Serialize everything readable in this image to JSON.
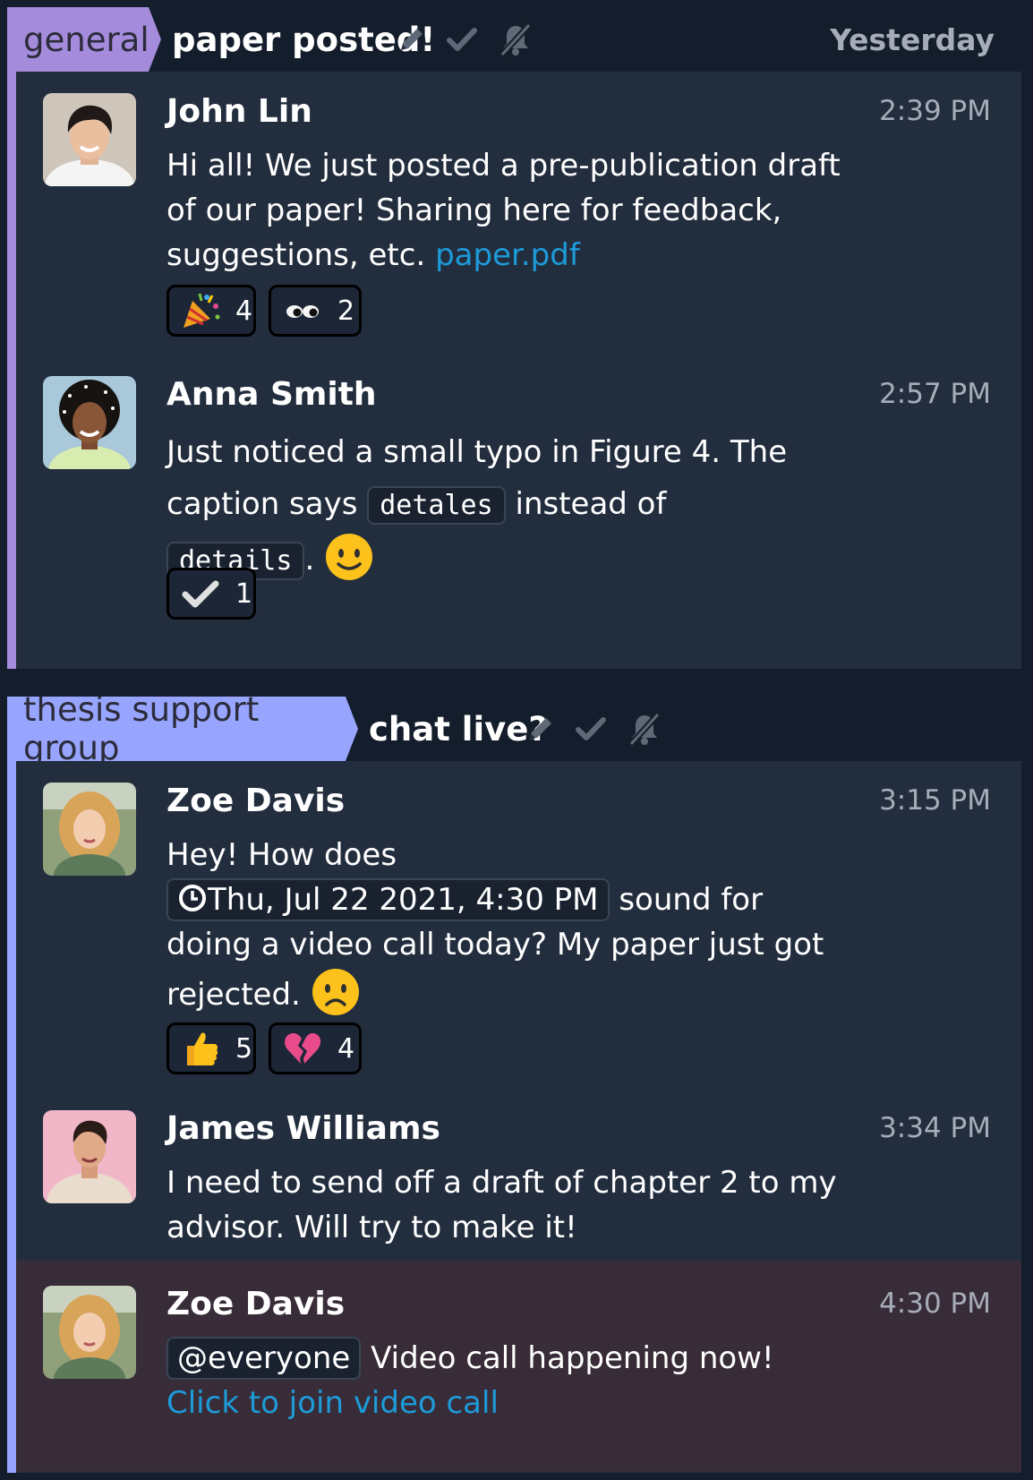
{
  "groups": [
    {
      "stream": "general",
      "stream_color": "#a48bdb",
      "topic": "paper posted!",
      "date": "Yesterday",
      "messages": [
        {
          "sender": "John Lin",
          "time": "2:39 PM",
          "text": "Hi all! We just posted a pre-publication draft of our paper! Sharing here for feedback, suggestions, etc. ",
          "link": "paper.pdf",
          "reactions": [
            {
              "emoji": "party-popper-icon",
              "count": "4"
            },
            {
              "emoji": "eyes-icon",
              "count": "2"
            }
          ]
        },
        {
          "sender": "Anna Smith",
          "time": "2:57 PM",
          "text_1": "Just noticed a small typo in Figure 4. The caption says ",
          "code_1": "detales",
          "text_2": " instead of",
          "code_2": "details",
          "text_3": ".",
          "reactions": [
            {
              "emoji": "check-icon",
              "count": "1"
            }
          ]
        }
      ]
    },
    {
      "stream": "thesis support group",
      "stream_color": "#97a5ff",
      "topic": "chat live?",
      "messages": [
        {
          "sender": "Zoe Davis",
          "time": "3:15 PM",
          "text_1": "Hey! How does",
          "time_mention": "Thu, Jul 22 2021, 4:30 PM",
          "text_2": " sound for doing a video call today? My paper just got rejected. ",
          "reactions": [
            {
              "emoji": "thumbs-up-icon",
              "count": "5"
            },
            {
              "emoji": "broken-heart-icon",
              "count": "4"
            }
          ]
        },
        {
          "sender": "James Williams",
          "time": "3:34 PM",
          "text": "I need to send off a draft of chapter 2 to my advisor. Will try to make it!"
        },
        {
          "sender": "Zoe Davis",
          "time": "4:30 PM",
          "mention": "@everyone",
          "text": " Video call happening now!",
          "link": "Click to join video call"
        }
      ]
    }
  ]
}
